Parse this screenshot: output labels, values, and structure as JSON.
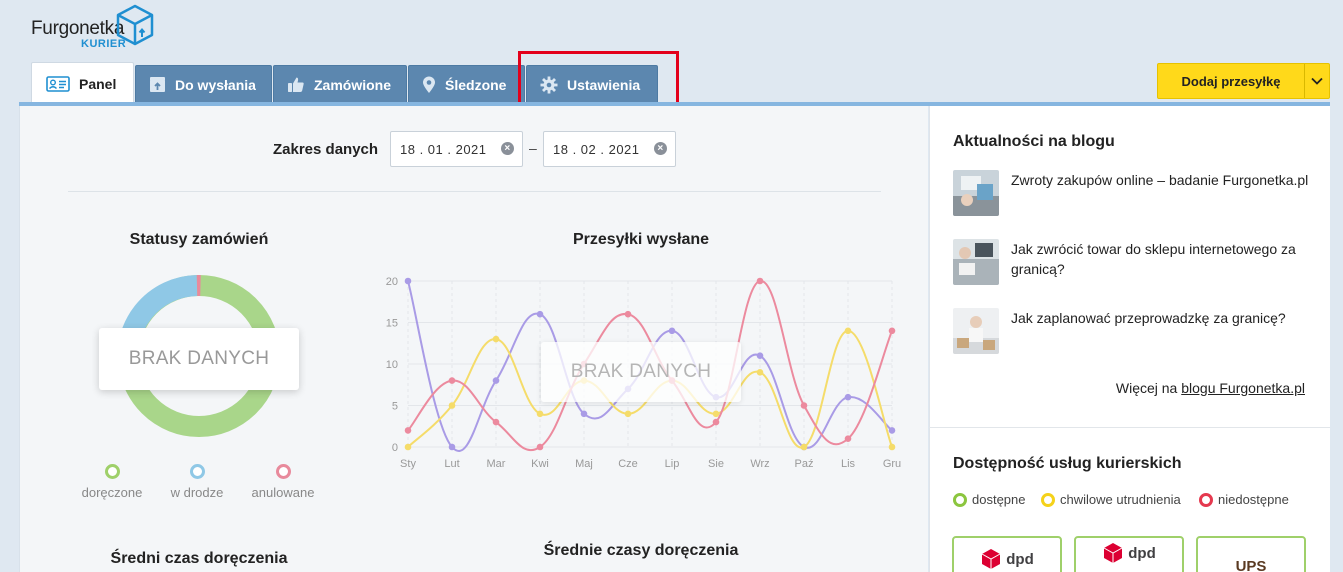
{
  "brand": {
    "name": "Furgonetka",
    "sub": "KURIER"
  },
  "tabs": [
    {
      "label": "Panel",
      "icon": "id-card-icon",
      "active": true
    },
    {
      "label": "Do wysłania",
      "icon": "box-upload-icon"
    },
    {
      "label": "Zamówione",
      "icon": "thumbs-up-icon"
    },
    {
      "label": "Śledzone",
      "icon": "location-pin-icon"
    },
    {
      "label": "Ustawienia",
      "icon": "gear-icon"
    }
  ],
  "add_button": {
    "label": "Dodaj przesyłkę"
  },
  "date_range": {
    "label": "Zakres danych",
    "from": "18 . 01 . 2021",
    "separator": "–",
    "to": "18 . 02 . 2021"
  },
  "statusy": {
    "title": "Statusy zamówień",
    "no_data": "BRAK DANYCH",
    "legend": [
      "doręczone",
      "w drodze",
      "anulowane"
    ],
    "colors": [
      "#9fd06a",
      "#8fc8e6",
      "#e88a9c"
    ]
  },
  "przesylki": {
    "title": "Przesyłki wysłane",
    "no_data": "BRAK DANYCH"
  },
  "sredni": {
    "title": "Średni czas doręczenia"
  },
  "srednie": {
    "title": "Średnie czasy doręczenia"
  },
  "chart_data": {
    "type": "line",
    "categories": [
      "Sty",
      "Lut",
      "Mar",
      "Kwi",
      "Maj",
      "Cze",
      "Lip",
      "Sie",
      "Wrz",
      "Paź",
      "Lis",
      "Gru"
    ],
    "yticks": [
      0,
      5,
      10,
      15,
      20
    ],
    "ylim": [
      0,
      20
    ],
    "series": [
      {
        "color": "#a99be6",
        "values": [
          20,
          0,
          8,
          16,
          4,
          7,
          14,
          6,
          11,
          0,
          6,
          2
        ]
      },
      {
        "color": "#f5dc6a",
        "values": [
          0,
          5,
          13,
          4,
          8,
          4,
          8,
          4,
          9,
          0,
          14,
          0
        ]
      },
      {
        "color": "#ec8a9e",
        "values": [
          2,
          8,
          3,
          0,
          10,
          16,
          8,
          3,
          20,
          5,
          1,
          14
        ]
      }
    ]
  },
  "blog": {
    "title": "Aktualności na blogu",
    "items": [
      {
        "title": "Zwroty zakupów online – badanie Furgonetka.pl"
      },
      {
        "title": "Jak zwrócić towar do sklepu internetowego za granicą?"
      },
      {
        "title": "Jak zaplanować przeprowadzkę za granicę?"
      }
    ],
    "more_prefix": "Więcej na ",
    "more_link": "blogu Furgonetka.pl"
  },
  "couriers": {
    "title": "Dostępność usług kurierskich",
    "legend": [
      {
        "label": "dostępne",
        "color": "#8cc63f"
      },
      {
        "label": "chwilowe utrudnienia",
        "color": "#f5d21a"
      },
      {
        "label": "niedostępne",
        "color": "#e5394f"
      }
    ],
    "cards": [
      "dpd",
      "dpd",
      "UPS"
    ]
  }
}
